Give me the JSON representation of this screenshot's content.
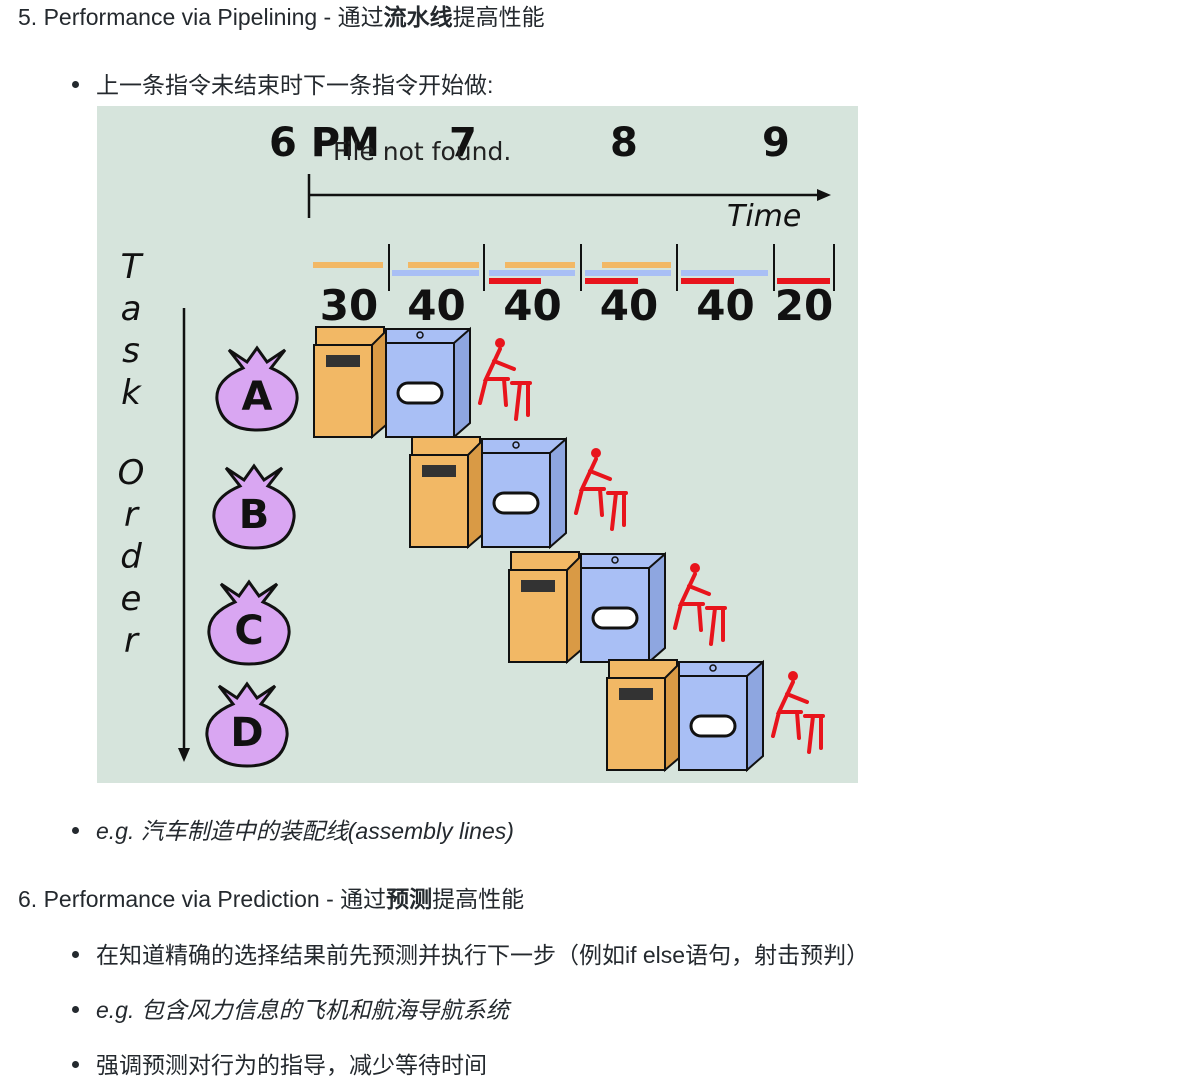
{
  "section5": {
    "number": "5.",
    "title_prefix": "Performance via Pipelining - 通过",
    "title_bold": "流水线",
    "title_suffix": "提高性能",
    "bullet_1": "上一条指令未结束时下一条指令开始做:",
    "bullet_2_eg": "e.g.",
    "bullet_2_text": " 汽车制造中的装配线(assembly lines)"
  },
  "figure": {
    "broken_image_text": "File not found.",
    "time_labels": [
      "6 PM",
      "7",
      "8",
      "9"
    ],
    "time_axis_label": "Time",
    "stage_durations": [
      "30",
      "40",
      "40",
      "40",
      "40",
      "20"
    ],
    "vertical_axis_letters": [
      "T",
      "a",
      "s",
      "k",
      "O",
      "r",
      "d",
      "e",
      "r"
    ],
    "tasks": [
      "A",
      "B",
      "C",
      "D"
    ],
    "colors": {
      "background": "#d6e4dc",
      "washer": "#f2b865",
      "dryer": "#a9bff5",
      "folder": "#e8141c",
      "bag": "#d9a6f2",
      "outline": "#111111"
    }
  },
  "section6": {
    "number": "6.",
    "title_prefix": "Performance via Prediction - 通过",
    "title_bold": "预测",
    "title_suffix": "提高性能",
    "bullet_1": "在知道精确的选择结果前先预测并执行下一步（例如if else语句，射击预判）",
    "bullet_2_eg": "e.g.",
    "bullet_2_text": " 包含风力信息的飞机和航海导航系统",
    "bullet_3": "强调预测对行为的指导，减少等待时间"
  }
}
